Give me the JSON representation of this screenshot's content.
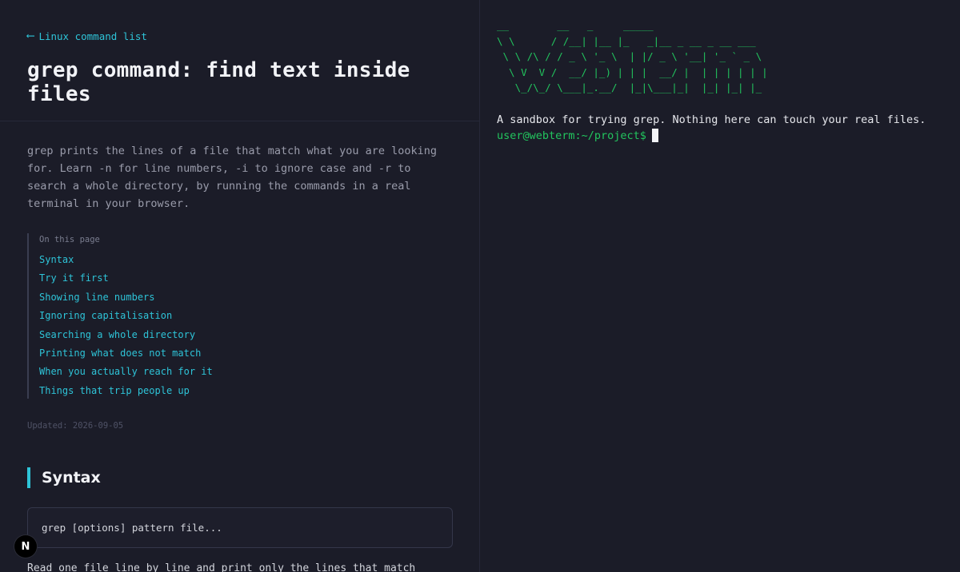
{
  "left_panel": {
    "back_link": {
      "icon": "arrow-left-icon",
      "arrow_glyph": "⟵",
      "label": "Linux command list"
    },
    "title": "grep command: find text inside files",
    "intro": "grep prints the lines of a file that match what you are looking for. Learn -n for line numbers, -i to ignore case and -r to search a whole directory, by running the commands in a real terminal in your browser.",
    "toc": {
      "heading": "On this page",
      "items": [
        "Syntax",
        "Try it first",
        "Showing line numbers",
        "Ignoring capitalisation",
        "Searching a whole directory",
        "Printing what does not match",
        "When you actually reach for it",
        "Things that trip people up"
      ]
    },
    "updated": "Updated: 2026-09-05",
    "syntax": {
      "heading": "Syntax",
      "code": "grep [options] pattern file..."
    },
    "next_text": "Read one file line by line and print only the lines that match"
  },
  "badge": {
    "icon": "nextjs-icon",
    "label": "N"
  },
  "terminal": {
    "ascii_banner": [
      "__        __   _     _____",
      "\\ \\      / /__| |__ |_   _|__ _ __ _ __ ___",
      " \\ \\ /\\ / / _ \\ '_ \\  | |/ _ \\ '__| '_ ` _ \\",
      "  \\ V  V /  __/ |_) | | |  __/ |  | | | | | |",
      "   \\_/\\_/ \\___|_.__/  |_|\\___|_|  |_| |_| |_"
    ],
    "message": "A sandbox for trying grep. Nothing here can touch your real files.",
    "prompt": "user@webterm:~/project$"
  },
  "colors": {
    "background": "#1b1c28",
    "accent": "#2ec4d8",
    "terminal_green": "#22c55e",
    "title": "#f2f3f7",
    "muted": "#9a9cab"
  }
}
